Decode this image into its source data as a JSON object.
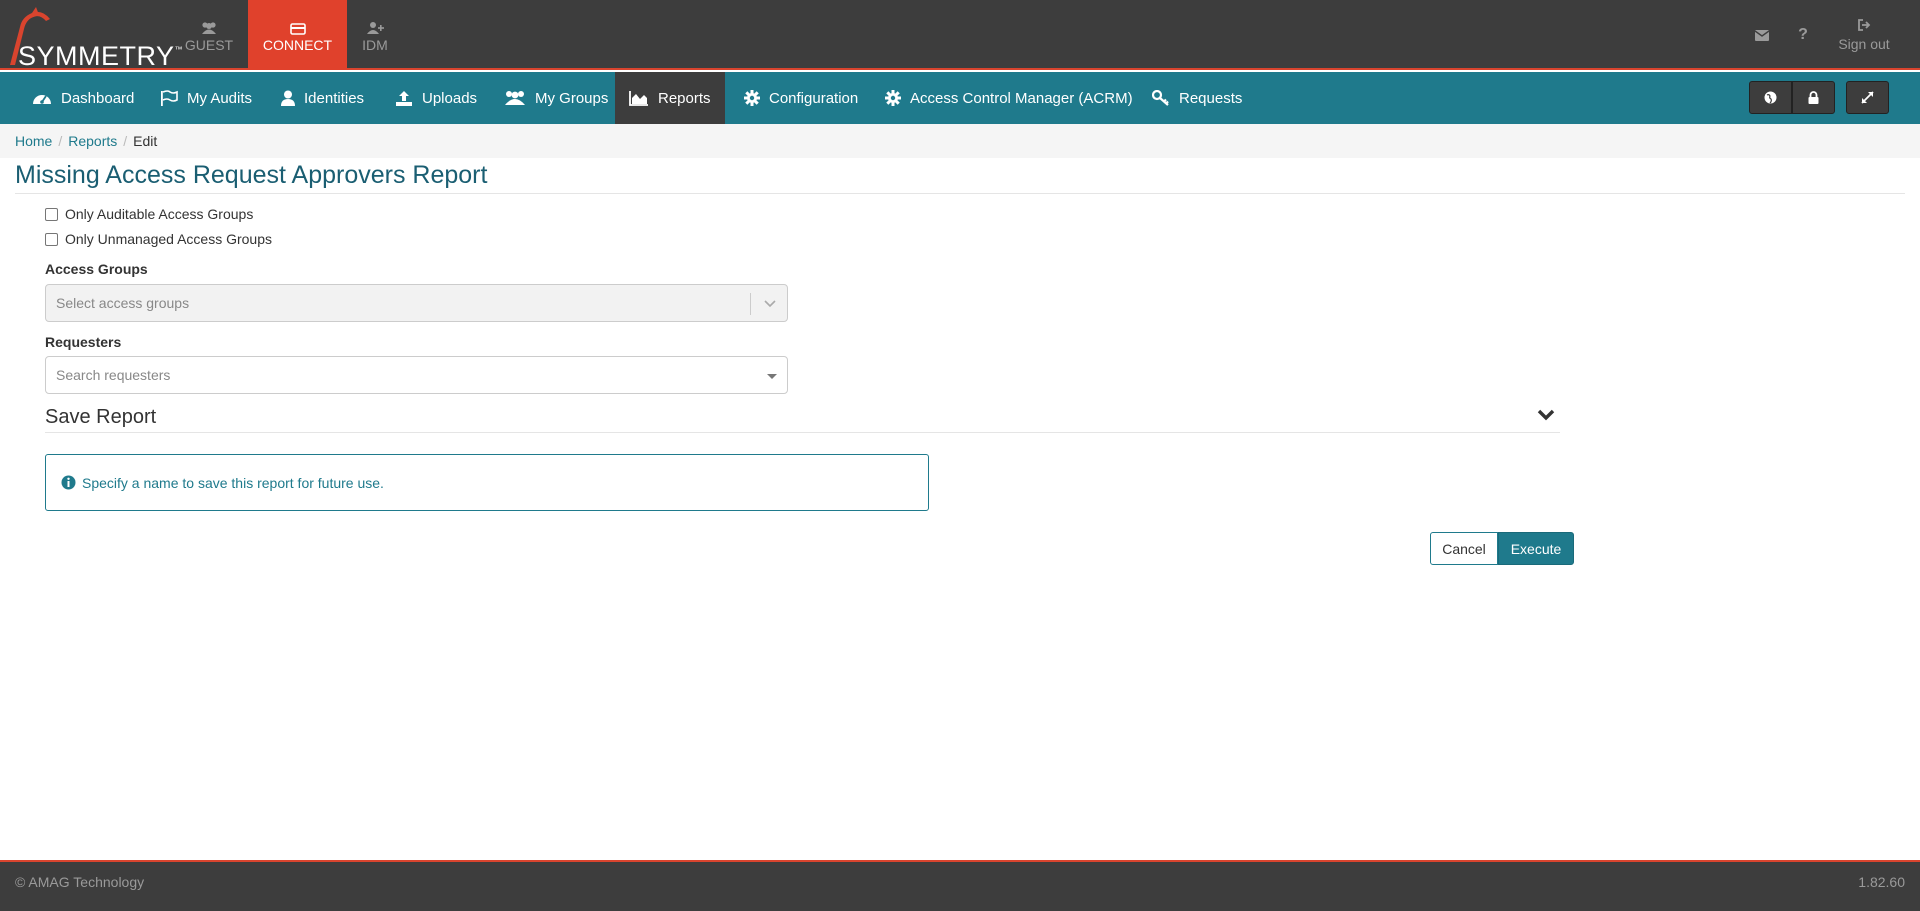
{
  "brand": {
    "name": "SYMMETRY",
    "tm": "™",
    "primary": "#1f7a8c",
    "accent": "#e0412c",
    "dark": "#3d3d3d"
  },
  "app_switch": [
    {
      "label": "GUEST",
      "icon": "users-icon",
      "active": false
    },
    {
      "label": "CONNECT",
      "icon": "card-icon",
      "active": true
    },
    {
      "label": "IDM",
      "icon": "user-plus-icon",
      "active": false
    }
  ],
  "topbar_right": {
    "mail_icon": "envelope-icon",
    "help_label": "?",
    "signout_label": "Sign out"
  },
  "nav": {
    "items": [
      {
        "label": "Dashboard",
        "icon": "dashboard-icon"
      },
      {
        "label": "My Audits",
        "icon": "flag-icon"
      },
      {
        "label": "Identities",
        "icon": "user-icon"
      },
      {
        "label": "Uploads",
        "icon": "upload-icon"
      },
      {
        "label": "My Groups",
        "icon": "group-icon"
      },
      {
        "label": "Reports",
        "icon": "area-chart-icon",
        "active": true
      },
      {
        "label": "Configuration",
        "icon": "gear-icon"
      },
      {
        "label": "Access Control Manager (ACRM)",
        "icon": "gear-icon"
      },
      {
        "label": "Requests",
        "icon": "key-icon"
      }
    ],
    "right_buttons": [
      "globe-icon",
      "lock-icon",
      "expand-icon"
    ]
  },
  "breadcrumb": {
    "home": "Home",
    "reports": "Reports",
    "current": "Edit"
  },
  "page": {
    "title": "Missing Access Request Approvers Report",
    "checkbox_auditable": "Only Auditable Access Groups",
    "checkbox_unmanaged": "Only Unmanaged Access Groups",
    "access_groups_label": "Access Groups",
    "access_groups_placeholder": "Select access groups",
    "requesters_label": "Requesters",
    "requesters_placeholder": "Search requesters",
    "save_report_title": "Save Report",
    "info_text": "Specify a name to save this report for future use.",
    "cancel_label": "Cancel",
    "execute_label": "Execute"
  },
  "footer": {
    "copyright": "© AMAG Technology",
    "version": "1.82.60"
  }
}
